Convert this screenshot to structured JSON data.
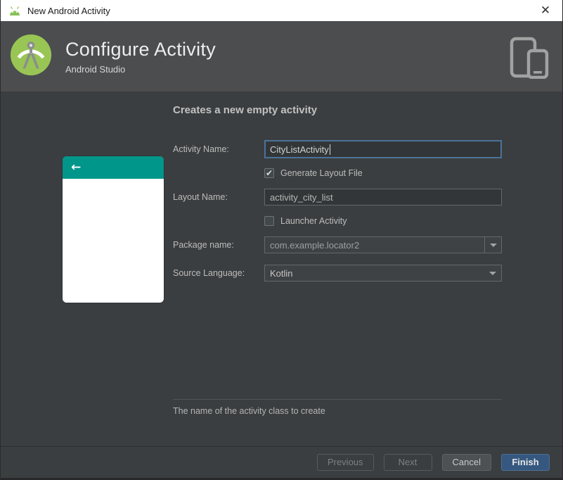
{
  "window": {
    "title": "New Android Activity",
    "close_glyph": "✕"
  },
  "header": {
    "title": "Configure Activity",
    "subtitle": "Android Studio"
  },
  "form": {
    "heading": "Creates a new empty activity",
    "activity_name": {
      "label": "Activity Name:",
      "value": "CityListActivity"
    },
    "generate_layout": {
      "label": "Generate Layout File",
      "checked": true,
      "glyph": "✔"
    },
    "layout_name": {
      "label": "Layout Name:",
      "value": "activity_city_list"
    },
    "launcher_activity": {
      "label": "Launcher Activity",
      "checked": false,
      "glyph": ""
    },
    "package_name": {
      "label": "Package name:",
      "value": "com.example.locator2"
    },
    "source_language": {
      "label": "Source Language:",
      "value": "Kotlin"
    }
  },
  "preview": {
    "back_glyph": "←"
  },
  "hint": "The name of the activity class to create",
  "footer": {
    "previous_label": "Previous",
    "next_label": "Next",
    "cancel_label": "Cancel",
    "finish_label": "Finish"
  },
  "colors": {
    "accent_blue": "#365880",
    "focus_border": "#4b7299",
    "preview_teal": "#00968a",
    "android_green": "#99c555",
    "header_gray": "#4b4d4f",
    "panel_gray": "#3b3e40"
  }
}
